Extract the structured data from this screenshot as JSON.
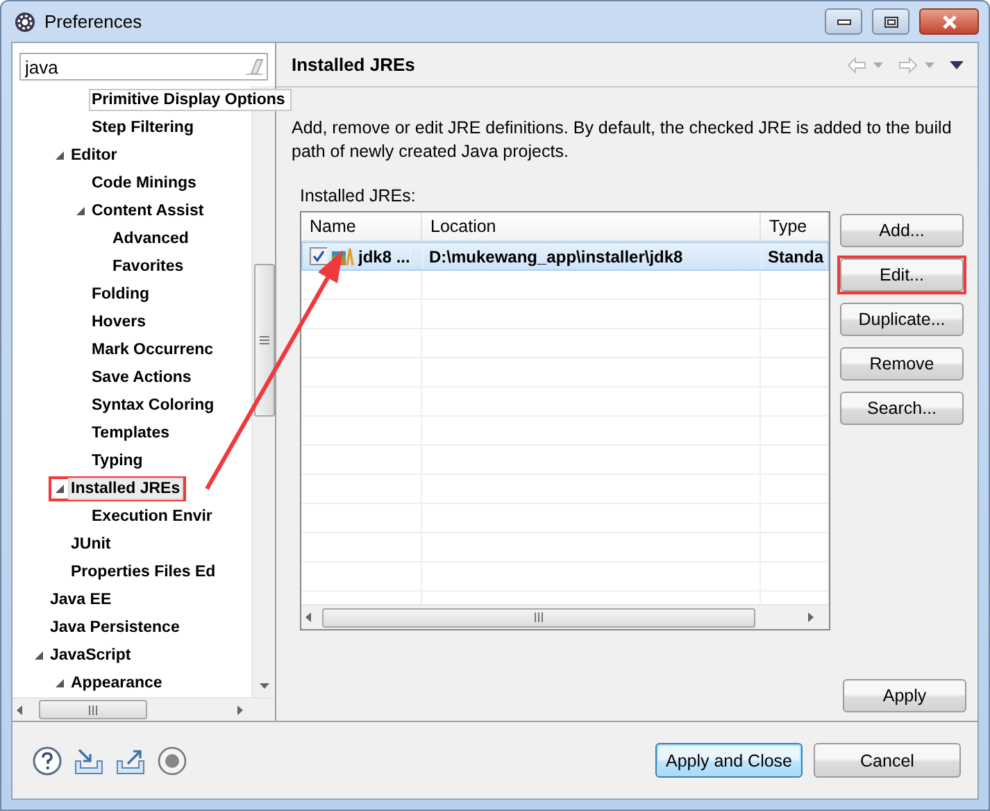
{
  "window": {
    "title": "Preferences"
  },
  "filter": {
    "value": "java"
  },
  "tree": {
    "items": [
      {
        "children": [
          {
            "children": [
              {
                "label": "Primitive Display Options",
                "selected": false,
                "hovered": true,
                "highlighted": false
              },
              {
                "label": "Step Filtering",
                "selected": false,
                "hovered": false,
                "highlighted": false
              }
            ]
          },
          {
            "label": "Editor",
            "selected": false,
            "hovered": false,
            "highlighted": false,
            "expanded": true,
            "children": [
              {
                "label": "Code Minings",
                "selected": false,
                "hovered": false,
                "highlighted": false
              },
              {
                "label": "Content Assist",
                "selected": false,
                "hovered": false,
                "highlighted": false,
                "expanded": true,
                "children": [
                  {
                    "label": "Advanced",
                    "selected": false,
                    "hovered": false,
                    "highlighted": false
                  },
                  {
                    "label": "Favorites",
                    "selected": false,
                    "hovered": false,
                    "highlighted": false
                  }
                ]
              },
              {
                "label": "Folding",
                "selected": false,
                "hovered": false,
                "highlighted": false
              },
              {
                "label": "Hovers",
                "selected": false,
                "hovered": false,
                "highlighted": false
              },
              {
                "label": "Mark Occurrenc",
                "selected": false,
                "hovered": false,
                "highlighted": false
              },
              {
                "label": "Save Actions",
                "selected": false,
                "hovered": false,
                "highlighted": false
              },
              {
                "label": "Syntax Coloring",
                "selected": false,
                "hovered": false,
                "highlighted": false
              },
              {
                "label": "Templates",
                "selected": false,
                "hovered": false,
                "highlighted": false
              },
              {
                "label": "Typing",
                "selected": false,
                "hovered": false,
                "highlighted": false
              }
            ]
          },
          {
            "label": "Installed JREs",
            "selected": true,
            "hovered": false,
            "highlighted": true,
            "expanded": true,
            "children": [
              {
                "label": "Execution Envir",
                "selected": false,
                "hovered": false,
                "highlighted": false
              }
            ]
          },
          {
            "label": "JUnit",
            "selected": false,
            "hovered": false,
            "highlighted": false
          },
          {
            "label": "Properties Files Ed",
            "selected": false,
            "hovered": false,
            "highlighted": false
          }
        ]
      },
      {
        "label": "Java EE",
        "selected": false,
        "hovered": false,
        "highlighted": false
      },
      {
        "label": "Java Persistence",
        "selected": false,
        "hovered": false,
        "highlighted": false
      },
      {
        "label": "JavaScript",
        "selected": false,
        "hovered": false,
        "highlighted": false,
        "expanded": true,
        "children": [
          {
            "label": "Appearance",
            "selected": false,
            "hovered": false,
            "highlighted": false,
            "expanded": true
          }
        ]
      }
    ]
  },
  "page": {
    "title": "Installed JREs",
    "description": "Add, remove or edit JRE definitions. By default, the checked JRE is added to the build path of newly created Java projects.",
    "table_label": "Installed JREs:"
  },
  "table": {
    "columns": [
      "Name",
      "Location",
      "Type"
    ],
    "rows": [
      {
        "checked": true,
        "selected": true,
        "name": "jdk8 ...",
        "location": "D:\\mukewang_app\\installer\\jdk8",
        "type": "Standa"
      }
    ]
  },
  "side_buttons": [
    {
      "label": "Add...",
      "highlighted": false
    },
    {
      "label": "Edit...",
      "highlighted": true
    },
    {
      "label": "Duplicate...",
      "highlighted": false
    },
    {
      "label": "Remove",
      "highlighted": false
    },
    {
      "label": "Search...",
      "highlighted": false
    }
  ],
  "apply_button": {
    "label": "Apply"
  },
  "footer_buttons": [
    {
      "label": "Apply and Close",
      "default": true
    },
    {
      "label": "Cancel",
      "default": false
    }
  ]
}
